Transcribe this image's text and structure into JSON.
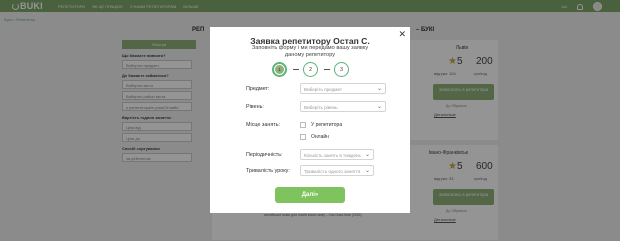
{
  "header": {
    "logo": "BUKI",
    "nav": [
      "РЕПЕТИТОРИ",
      "ЯК ЦЕ ПРАЦЮЄ",
      "З НАМИ РЕПЕТИТОРАМ",
      "БІЛЬШЕ"
    ],
    "lang": "UA"
  },
  "breadcrumb": "Буки › Репетитор",
  "page_heading_left": "РЕП",
  "page_heading_right": "– БУКІ",
  "filters": {
    "button": "Фільтри",
    "q1": "Що бажаєте вивчати?",
    "q1_value": "Виберіть предмет",
    "q2": "Де бажаєте займатися?",
    "q2_value1": "Виберіть місто",
    "q2_value2": "Виберіть район міста",
    "q2_value3": "у репетитора/в учня/Онлайн",
    "q3": "Вартість годинн заняття:",
    "from": "Ціна від",
    "to": "Ціна до",
    "q4": "Спосіб сортування",
    "sort": "за рейтингом"
  },
  "cards": [
    {
      "city": "Львів",
      "rating": "5",
      "price": "200",
      "reviews": "відгуки: 104",
      "unit": "грн/год",
      "button": "Записатись в репетитора",
      "fav": "До Обраного",
      "more": "Детальніше"
    },
    {
      "city": "Івано-Франківськ",
      "rating": "5",
      "price": "600",
      "reviews": "відгуки: 33",
      "unit": "грн/год",
      "button": "Записатись в репетитора",
      "fav": "До Обраного",
      "more": "Детальніше"
    }
  ],
  "card_desc": "сертифікований викладач англійської мови – міжнародний диплом TESOL (викладання англійської мови для носіїв інших мов) – Cas Dass Київ (2016)",
  "modal": {
    "title": "Заявка репетитору Остап С.",
    "subtitle": "Заповніть форму і ми передамо вашу заявку даному репетитору",
    "steps": [
      "1",
      "2",
      "3"
    ],
    "subject_label": "Предмет:",
    "subject_placeholder": "Виберіть предмет",
    "level_label": "Рівень:",
    "level_placeholder": "Виберіть рівень",
    "place_label": "Місце занять:",
    "place_option1": "У репетитора",
    "place_option2": "Онлайн",
    "frequency_label": "Періодичність:",
    "frequency_placeholder": "Кількість занять в тиждень",
    "duration_label": "Тривалість уроку:",
    "duration_placeholder": "Тривалість одного заняття",
    "submit": "Далі»"
  }
}
